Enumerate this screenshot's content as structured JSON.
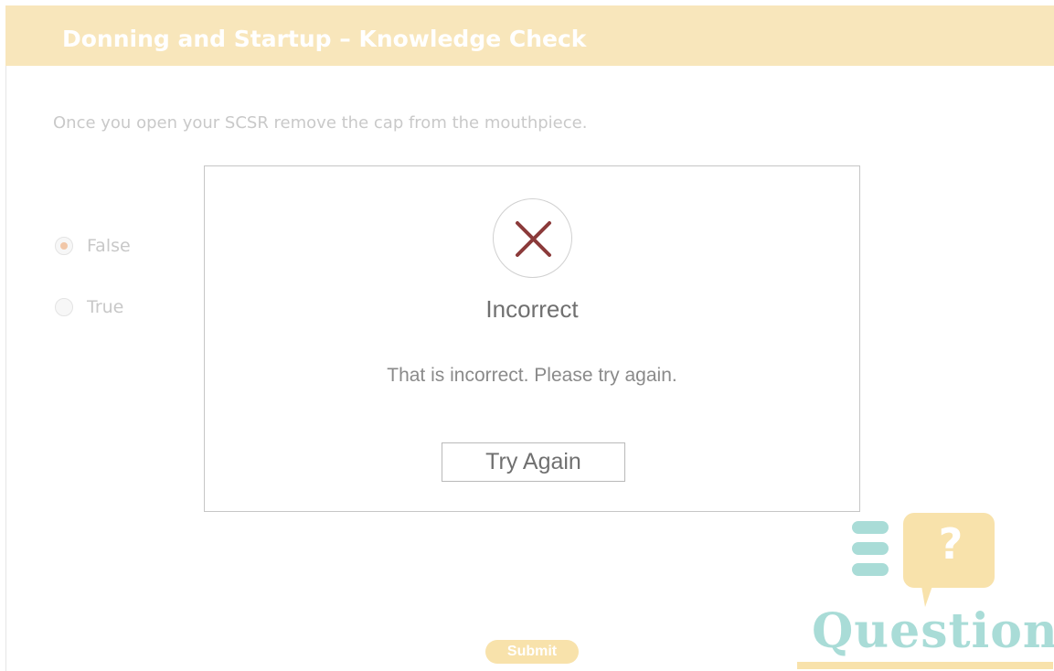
{
  "header": {
    "title": "Donning and Startup – Knowledge Check"
  },
  "question": {
    "text": "Once you open your SCSR remove the cap from the mouthpiece."
  },
  "options": [
    {
      "label": "False",
      "selected": true
    },
    {
      "label": "True",
      "selected": false
    }
  ],
  "dialog": {
    "icon": "x-icon",
    "title": "Incorrect",
    "message": "That is incorrect. Please try again.",
    "button_label": "Try Again"
  },
  "submit": {
    "label": "Submit"
  },
  "logo": {
    "word": "Question",
    "bubble_symbol": "?",
    "colors": {
      "teal": "#a9dcd7",
      "yellow": "#f8e2ab"
    }
  },
  "colors": {
    "title_bar": "#f8e6bb",
    "x_mark": "#8b3a3a",
    "radio_selected": "#f1c7a8"
  }
}
